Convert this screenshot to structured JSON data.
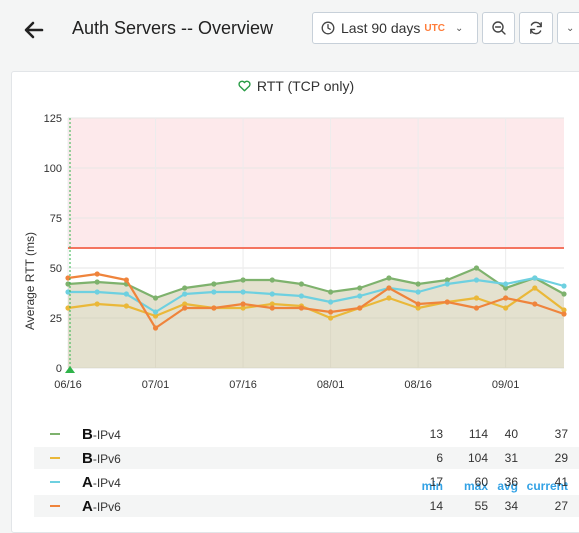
{
  "header": {
    "title": "Auth Servers -- Overview",
    "time_range_label": "Last 90 days",
    "timezone_label": "UTC"
  },
  "panel": {
    "title": "RTT (TCP only)",
    "y_axis_label": "Average RTT (ms)",
    "legend_columns": [
      "min",
      "max",
      "avg",
      "current"
    ],
    "legend": [
      {
        "prefix": "B",
        "suffix": "-IPv4",
        "color": "#7eb26d",
        "min": "13",
        "max": "114",
        "avg": "40",
        "current": "37"
      },
      {
        "prefix": "B",
        "suffix": "-IPv6",
        "color": "#eab839",
        "min": "6",
        "max": "104",
        "avg": "31",
        "current": "29"
      },
      {
        "prefix": "A",
        "suffix": "-IPv4",
        "color": "#6ed0e0",
        "min": "17",
        "max": "60",
        "avg": "36",
        "current": "41"
      },
      {
        "prefix": "A",
        "suffix": "-IPv6",
        "color": "#ef843c",
        "min": "14",
        "max": "55",
        "avg": "34",
        "current": "27"
      }
    ]
  },
  "chart_data": {
    "type": "line",
    "ylabel": "Average RTT (ms)",
    "ylim": [
      0,
      125
    ],
    "y_ticks": [
      "0",
      "25",
      "50",
      "75",
      "100",
      "125"
    ],
    "x_ticks": [
      "06/16",
      "07/01",
      "07/16",
      "08/01",
      "08/16",
      "09/01"
    ],
    "threshold": 60,
    "threshold_color": "#f47560",
    "annotation_x": "06/16",
    "x": [
      "06/16",
      "06/21",
      "06/26",
      "07/01",
      "07/06",
      "07/11",
      "07/16",
      "07/21",
      "07/26",
      "08/01",
      "08/06",
      "08/11",
      "08/16",
      "08/21",
      "08/26",
      "09/01",
      "09/06",
      "09/10"
    ],
    "series": [
      {
        "name": "B-IPv4",
        "color": "#7eb26d",
        "values": [
          42,
          43,
          42,
          35,
          40,
          42,
          44,
          44,
          42,
          38,
          40,
          45,
          42,
          44,
          50,
          40,
          45,
          37
        ]
      },
      {
        "name": "B-IPv6",
        "color": "#eab839",
        "values": [
          30,
          32,
          31,
          26,
          32,
          30,
          30,
          32,
          31,
          25,
          30,
          35,
          30,
          33,
          35,
          30,
          40,
          29
        ]
      },
      {
        "name": "A-IPv4",
        "color": "#6ed0e0",
        "values": [
          38,
          38,
          37,
          28,
          37,
          38,
          38,
          37,
          36,
          33,
          36,
          40,
          38,
          42,
          44,
          42,
          45,
          41
        ]
      },
      {
        "name": "A-IPv6",
        "color": "#ef843c",
        "values": [
          45,
          47,
          44,
          20,
          30,
          30,
          32,
          30,
          30,
          28,
          30,
          40,
          32,
          33,
          30,
          35,
          32,
          27
        ]
      }
    ]
  }
}
